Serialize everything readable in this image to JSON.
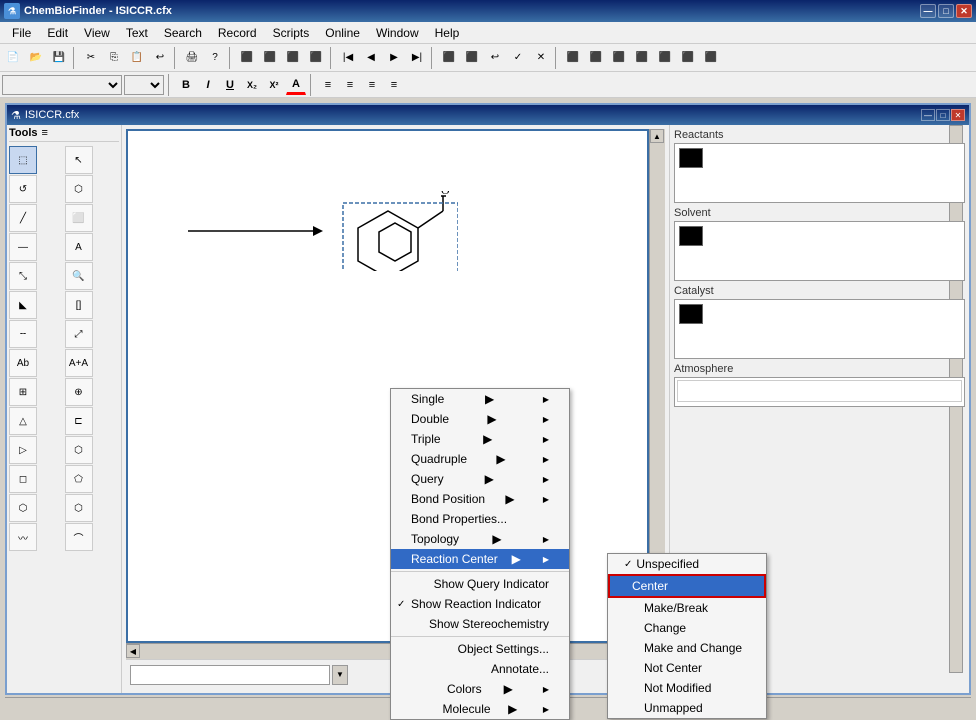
{
  "titleBar": {
    "title": "ChemBioFinder - ISICCR.cfx",
    "icon": "C",
    "buttons": {
      "minimize": "—",
      "maximize": "□",
      "close": "✕"
    }
  },
  "menuBar": {
    "items": [
      "File",
      "Edit",
      "View",
      "Text",
      "Search",
      "Record",
      "Scripts",
      "Online",
      "Window",
      "Help"
    ]
  },
  "innerWindow": {
    "title": "ISICCR.cfx",
    "buttons": {
      "minimize": "—",
      "maximize": "□",
      "close": "✕"
    }
  },
  "tools": {
    "header": "Tools"
  },
  "rightPanel": {
    "reactantsLabel": "Reactants",
    "solventLabel": "Solvent",
    "catalystLabel": "Catalyst",
    "atmosphereLabel": "Atmosphere"
  },
  "contextMenu": {
    "items": [
      {
        "label": "Single",
        "hasSub": true
      },
      {
        "label": "Double",
        "hasSub": true
      },
      {
        "label": "Triple",
        "hasSub": true
      },
      {
        "label": "Quadruple",
        "hasSub": true
      },
      {
        "label": "Query",
        "hasSub": true
      },
      {
        "label": "Bond Position",
        "hasSub": true
      },
      {
        "label": "Bond Properties...",
        "hasSub": false
      },
      {
        "label": "Topology",
        "hasSub": true
      },
      {
        "label": "Reaction Center",
        "hasSub": true,
        "active": true
      },
      {
        "label": "Show Query Indicator",
        "hasSub": false
      },
      {
        "label": "Show Reaction Indicator",
        "hasSub": false,
        "checked": true
      },
      {
        "label": "Show Stereochemistry",
        "hasSub": false
      },
      {
        "label": "Object Settings...",
        "hasSub": false
      },
      {
        "label": "Annotate...",
        "hasSub": false
      },
      {
        "label": "Colors",
        "hasSub": true
      },
      {
        "label": "Molecule",
        "hasSub": true
      }
    ]
  },
  "subMenu": {
    "items": [
      {
        "label": "Unspecified",
        "checked": true
      },
      {
        "label": "Center",
        "highlighted": true
      },
      {
        "label": "Make/Break"
      },
      {
        "label": "Change"
      },
      {
        "label": "Make and Change"
      },
      {
        "label": "Not Center"
      },
      {
        "label": "Not Modified"
      },
      {
        "label": "Unmapped"
      }
    ]
  }
}
